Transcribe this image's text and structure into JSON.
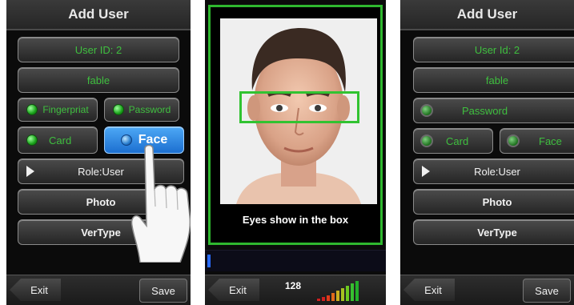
{
  "screens": [
    {
      "title": "Add User",
      "user_id": "User ID: 2",
      "name": "fable",
      "fingerprint": "Fingerpriat",
      "password": "Password",
      "card": "Card",
      "face": "Face",
      "role": "Role:User",
      "photo": "Photo",
      "vertype": "VerType",
      "exit": "Exit",
      "save": "Save"
    },
    {
      "caption": "Eyes show in the box",
      "exit": "Exit",
      "quality_score": "128"
    },
    {
      "title": "Add User",
      "user_id": "User Id: 2",
      "name": "fable",
      "password": "Password",
      "card": "Card",
      "face": "Face",
      "role": "Role:User",
      "photo": "Photo",
      "vertype": "VerType",
      "exit": "Exit",
      "save": "Save"
    }
  ],
  "colors": {
    "accent_green": "#3fbf3f",
    "selected_blue": "#2a7fd0",
    "frame_green": "#2fb82f"
  },
  "icons": [
    "hand-pointer-icon",
    "play-triangle-icon",
    "radio-dot-icon",
    "signal-bars-icon",
    "back-arrow-icon"
  ]
}
